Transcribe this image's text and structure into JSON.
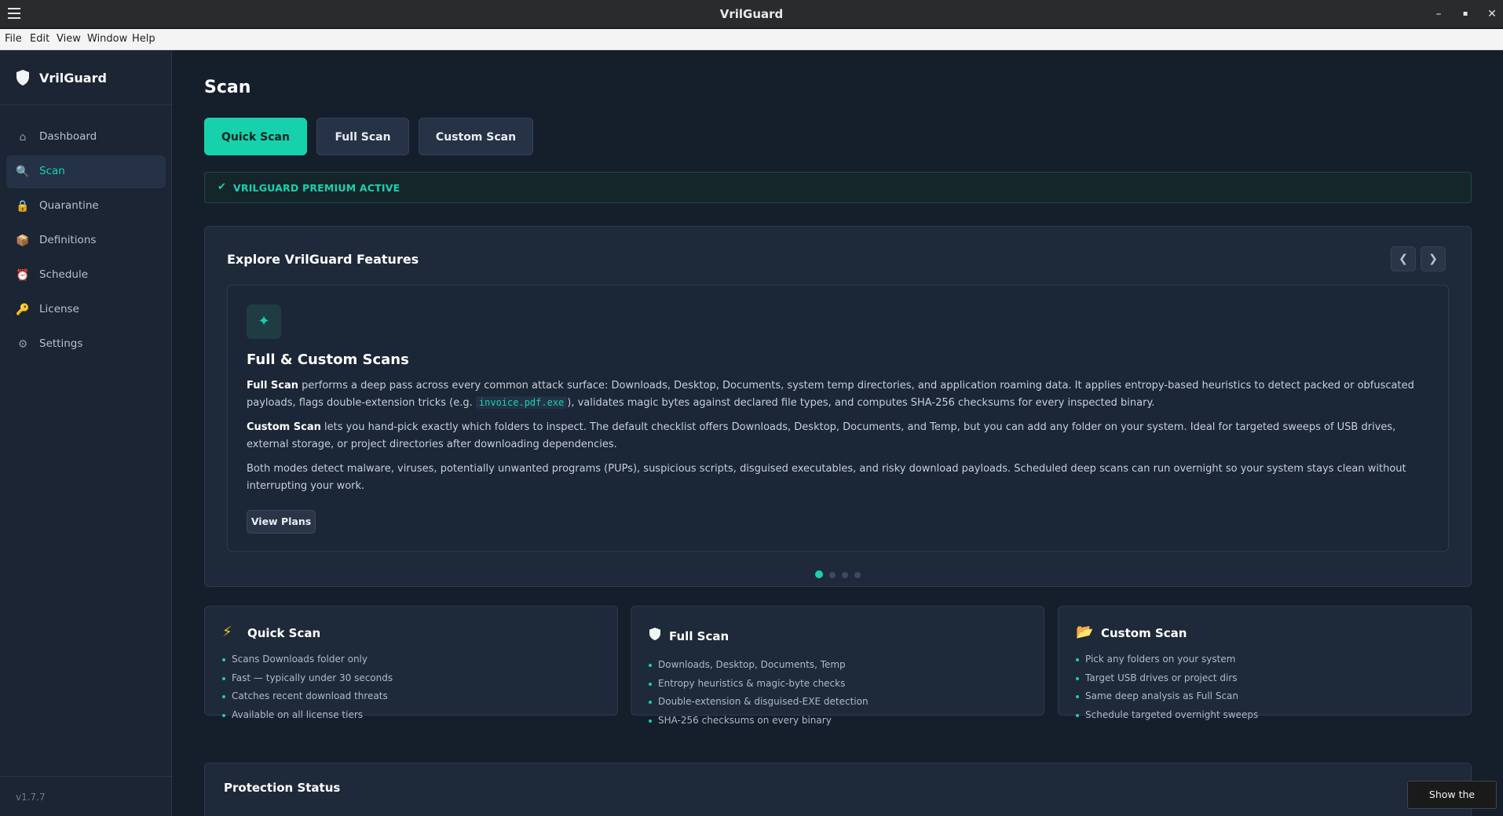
{
  "window": {
    "title": "VrilGuard",
    "minimize": "–",
    "maximize": "▪",
    "close": "✕"
  },
  "menubar": {
    "items": [
      "File",
      "Edit",
      "View",
      "Window",
      "Help"
    ]
  },
  "sidebar": {
    "brand": "VrilGuard",
    "items": [
      {
        "label": "Dashboard",
        "icon": "home-icon",
        "glyph": "⌂"
      },
      {
        "label": "Scan",
        "icon": "search-icon",
        "glyph": "🔍"
      },
      {
        "label": "Quarantine",
        "icon": "lock-icon",
        "glyph": "🔒"
      },
      {
        "label": "Definitions",
        "icon": "package-icon",
        "glyph": "📦"
      },
      {
        "label": "Schedule",
        "icon": "alarm-clock-icon",
        "glyph": "⏰"
      },
      {
        "label": "License",
        "icon": "key-icon",
        "glyph": "🔑"
      },
      {
        "label": "Settings",
        "icon": "gear-icon",
        "glyph": "⚙"
      }
    ],
    "version": "v1.7.7"
  },
  "page": {
    "title": "Scan"
  },
  "scan_buttons": {
    "quick": "Quick Scan",
    "full": "Full Scan",
    "custom": "Custom Scan"
  },
  "premium": {
    "check": "✔",
    "text": "VRILGUARD PREMIUM ACTIVE"
  },
  "features": {
    "title": "Explore VrilGuard Features",
    "prev": "❮",
    "next": "❯",
    "slide": {
      "icon_glyph": "✦",
      "title": "Full & Custom Scans",
      "p1_bold": "Full Scan",
      "p1_text_a": " performs a deep pass across every common attack surface: Downloads, Desktop, Documents, system temp directories, and application roaming data. It applies entropy-based heuristics to detect packed or obfuscated payloads, flags double-extension tricks (e.g. ",
      "p1_code": "invoice.pdf.exe",
      "p1_text_b": "), validates magic bytes against declared file types, and computes SHA-256 checksums for every inspected binary.",
      "p2_bold": "Custom Scan",
      "p2_text": " lets you hand-pick exactly which folders to inspect. The default checklist offers Downloads, Desktop, Documents, and Temp, but you can add any folder on your system. Ideal for targeted sweeps of USB drives, external storage, or project directories after downloading dependencies.",
      "p3_text": "Both modes detect malware, viruses, potentially unwanted programs (PUPs), suspicious scripts, disguised executables, and risky download payloads. Scheduled deep scans can run overnight so your system stays clean without interrupting your work.",
      "button": "View Plans"
    },
    "slide_count": 4,
    "active_slide": 1
  },
  "cards": [
    {
      "title": "Quick Scan",
      "icon": "lightning-icon",
      "glyph": "⚡",
      "items": [
        "Scans Downloads folder only",
        "Fast — typically under 30 seconds",
        "Catches recent download threats",
        "Available on all license tiers"
      ]
    },
    {
      "title": "Full Scan",
      "icon": "shield-icon",
      "glyph": "",
      "items": [
        "Downloads, Desktop, Documents, Temp",
        "Entropy heuristics & magic-byte checks",
        "Double-extension & disguised-EXE detection",
        "SHA-256 checksums on every binary"
      ]
    },
    {
      "title": "Custom Scan",
      "icon": "folder-open-icon",
      "glyph": "📂",
      "items": [
        "Pick any folders on your system",
        "Target USB drives or project dirs",
        "Same deep analysis as Full Scan",
        "Schedule targeted overnight sweeps"
      ]
    }
  ],
  "protection": {
    "title": "Protection Status"
  },
  "tooltip": {
    "text": "Show the desktop"
  },
  "colors": {
    "accent": "#18d1b1",
    "background": "#151e2b",
    "panel": "#1e2a3a",
    "sidebar": "#1b2533"
  }
}
